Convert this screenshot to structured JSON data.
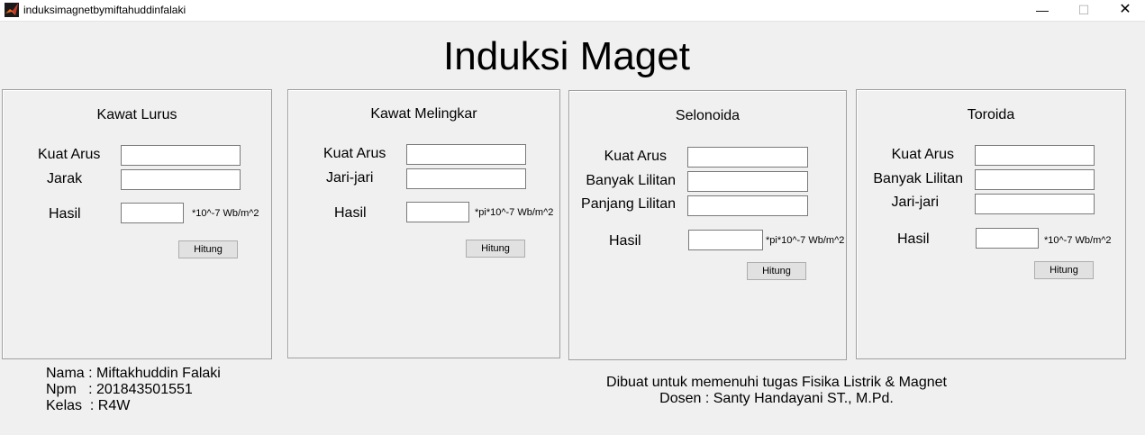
{
  "window": {
    "title": "induksimagnetbymiftahuddinfalaki",
    "minimize_glyph": "—",
    "maximize_glyph": "☐",
    "close_glyph": "✕",
    "icon": "matlab-icon"
  },
  "main_title": "Induksi Maget",
  "panels": {
    "kawat_lurus": {
      "title": "Kawat Lurus",
      "kuat_arus_label": "Kuat Arus",
      "jarak_label": "Jarak",
      "hasil_label": "Hasil",
      "unit": "*10^-7 Wb/m^2",
      "button": "Hitung"
    },
    "kawat_melingkar": {
      "title": "Kawat Melingkar",
      "kuat_arus_label": "Kuat Arus",
      "jari_label": "Jari-jari",
      "hasil_label": "Hasil",
      "unit": "*pi*10^-7 Wb/m^2",
      "button": "Hitung"
    },
    "selonoida": {
      "title": "Selonoida",
      "kuat_arus_label": "Kuat Arus",
      "lilitan_label": "Banyak Lilitan",
      "panjang_label": "Panjang Lilitan",
      "hasil_label": "Hasil",
      "unit": "*pi*10^-7 Wb/m^2",
      "button": "Hitung"
    },
    "toroida": {
      "title": "Toroida",
      "kuat_arus_label": "Kuat Arus",
      "lilitan_label": "Banyak Lilitan",
      "jari_label": "Jari-jari",
      "hasil_label": "Hasil",
      "unit": "*10^-7 Wb/m^2",
      "button": "Hitung"
    }
  },
  "footer": {
    "nama": "Nama : Miftakhuddin Falaki",
    "npm": "Npm   : 201843501551",
    "kelas": "Kelas  : R4W",
    "purpose": "Dibuat untuk memenuhi tugas Fisika Listrik & Magnet",
    "dosen": "Dosen : Santy Handayani ST., M.Pd."
  }
}
